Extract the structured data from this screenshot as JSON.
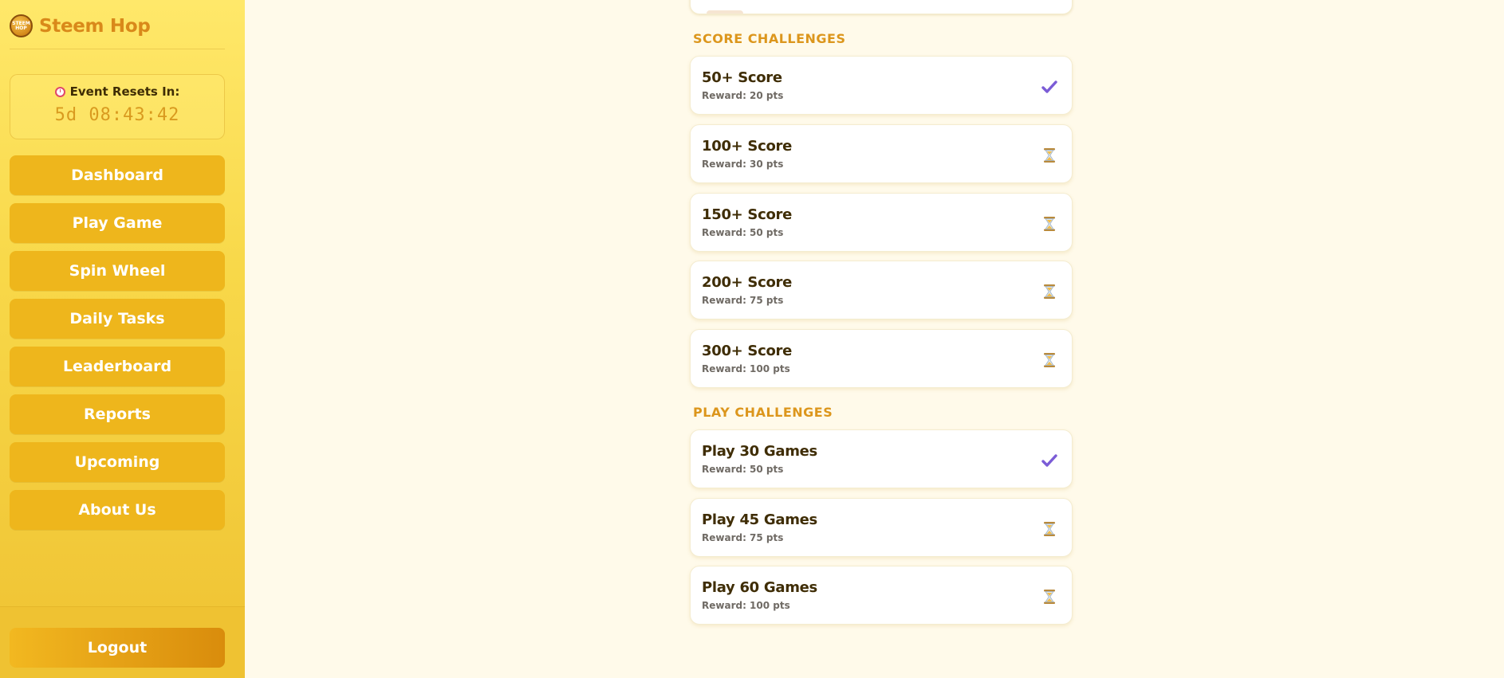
{
  "app": {
    "name": "Steem Hop",
    "logo_text": "STEEM HOP"
  },
  "timer": {
    "label": "Event Resets In:",
    "value": "5d 08:43:42"
  },
  "nav": {
    "items": [
      {
        "label": "Dashboard"
      },
      {
        "label": "Play Game"
      },
      {
        "label": "Spin Wheel"
      },
      {
        "label": "Daily Tasks"
      },
      {
        "label": "Leaderboard"
      },
      {
        "label": "Reports"
      },
      {
        "label": "Upcoming"
      },
      {
        "label": "About Us"
      }
    ],
    "logout": "Logout"
  },
  "sections": {
    "score": {
      "title": "SCORE CHALLENGES",
      "items": [
        {
          "title": "50+ Score",
          "reward": "Reward: 20 pts",
          "status": "check-icon"
        },
        {
          "title": "100+ Score",
          "reward": "Reward: 30 pts",
          "status": "hourglass-icon"
        },
        {
          "title": "150+ Score",
          "reward": "Reward: 50 pts",
          "status": "hourglass-icon"
        },
        {
          "title": "200+ Score",
          "reward": "Reward: 75 pts",
          "status": "hourglass-icon"
        },
        {
          "title": "300+ Score",
          "reward": "Reward: 100 pts",
          "status": "hourglass-icon"
        }
      ]
    },
    "play": {
      "title": "PLAY CHALLENGES",
      "items": [
        {
          "title": "Play 30 Games",
          "reward": "Reward: 50 pts",
          "status": "check-icon"
        },
        {
          "title": "Play 45 Games",
          "reward": "Reward: 75 pts",
          "status": "hourglass-icon"
        },
        {
          "title": "Play 60 Games",
          "reward": "Reward: 100 pts",
          "status": "hourglass-icon"
        }
      ]
    }
  },
  "colors": {
    "accent": "#dc961c",
    "nav_button": "#eeb61c",
    "check": "#7b5cd6",
    "page_bg": "#fffaea"
  }
}
